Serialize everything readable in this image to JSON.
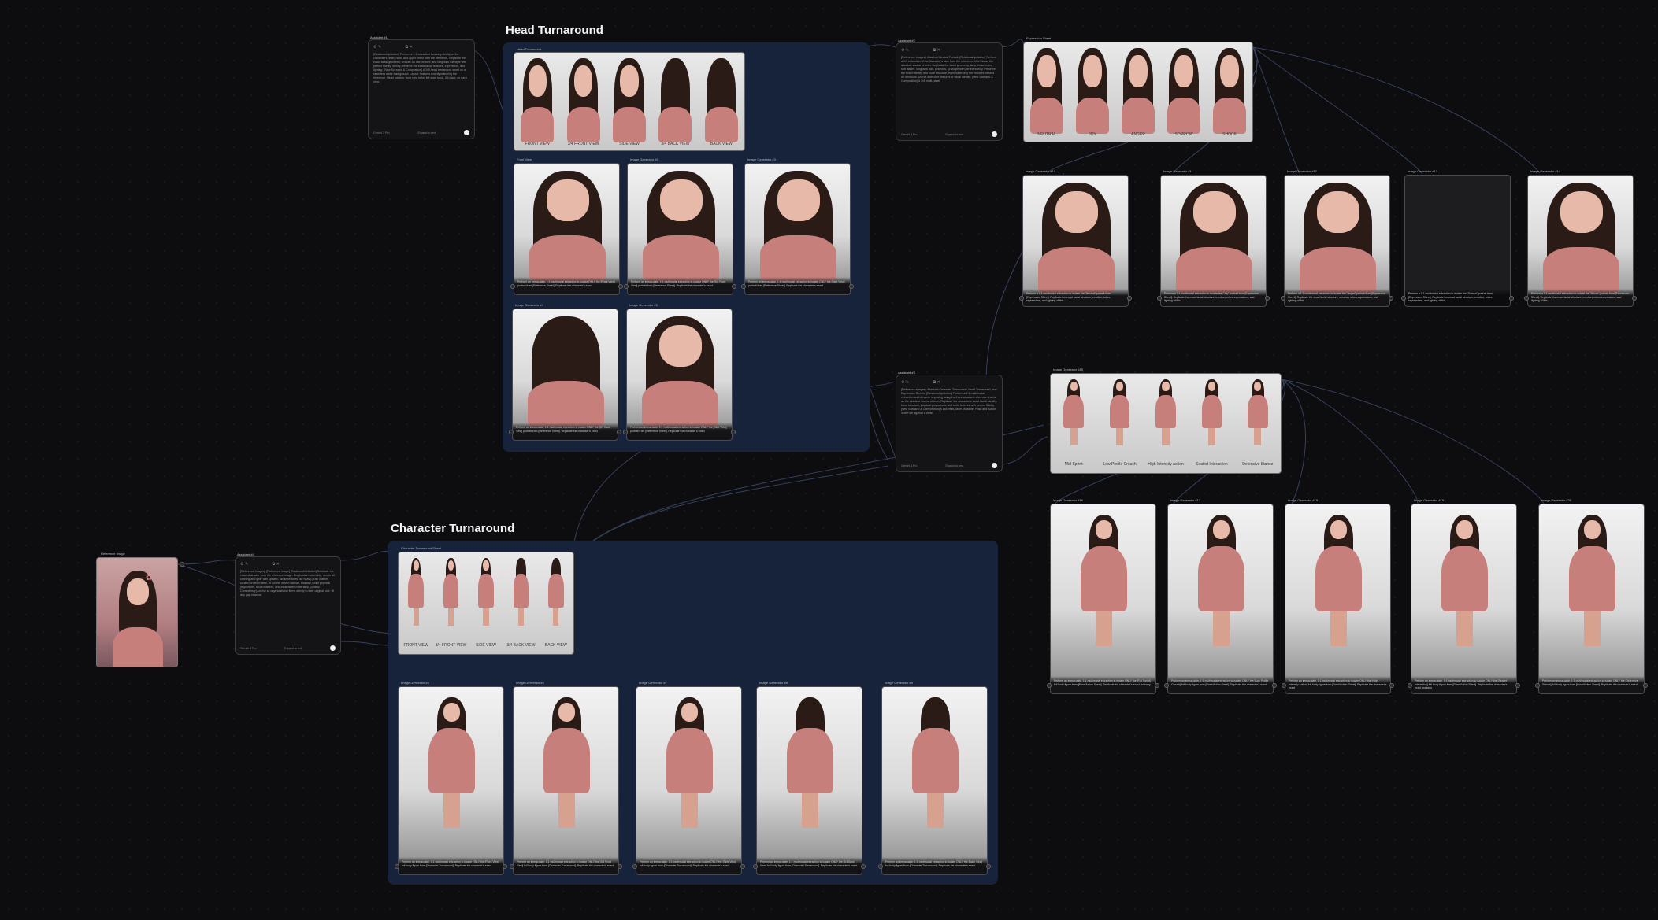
{
  "groups": {
    "head_title": "Head Turnaround",
    "character_title": "Character Turnaround"
  },
  "reference": {
    "label": "Reference Image"
  },
  "assistants": {
    "a1": {
      "title": "Assistant #1",
      "body": "[Relationship/Action] Perform a 1:1 extraction focusing strictly on the character's head, neck, and upper chest from the reference. Replicate the exact facial geometry, smooth 3D skin texture, and long dark hairstyle with perfect fidelity. Strictly preserve the exact facial features, expression, and lighting. [New Scenario & Composition] A 2x5 head turnaround sheet on a seamless white background. Layout: features exactly matching the reference. Head rotation: front view to full left side, back, 3/4 back; on each view.",
      "mode": "Gemini 3 Pro",
      "action": "Expand to text"
    },
    "a2": {
      "title": "Assistant #2",
      "body": "[Reference Images]: Attached Neutral Portrait. [Relationship/Action] Perform a 1:1 extraction of the character's face from the reference. Use this as the absolute source of truth. Replicate the facial geometry, large brown eyes, soft lashes, long dark hair, pink bow, lip shape with perfect fidelity. Preserve the exact identity and bone structure, manipulate only the muscles needed for emotions. Do not alter core features or facial identity. [New Scenario & Composition] A 1x5 multi-panel",
      "mode": "Gemini 3 Pro",
      "action": "Expand to text"
    },
    "a3": {
      "title": "Assistant #3",
      "body": "[Reference Images]: Attached Character Turnaround, Head Turnaround, and Expression Sheets. [Relationship/Action] Perform a 1:1 multimodal extraction and dynamic re-posing using the three attached reference sheets as the absolute source of truth. Replicate the character's exact facial identity, bone structure, physical proportions, and outfit textures with perfect fidelity. [New Scenario & Composition] A 1x5 multi-panel character Pose and Action Sheet set against a clean,",
      "mode": "Gemini 3 Pro",
      "action": "Expand to text"
    },
    "a4": {
      "title": "Assistant #4",
      "body": "[Reference Images]: [Reference Image] [Relationship/Action] Replicate the exact character from the reference image. Emphasize materiality: render all clothing and gear with specific, tactile textures like heavy-grain leather, scuffed brushed steel, or coarse woven canvas. Maintain exact physical proportions, facial features, and established materiality. [Spatial Consistency] Anchor all organizational items strictly to their original side, fill any gap or arrow.",
      "mode": "Gemini 3 Pro",
      "action": "Expand to text"
    }
  },
  "head_sheet": {
    "label": "Head Turnaround",
    "views": [
      "FRONT VIEW",
      "3/4 FRONT VIEW",
      "SIDE VIEW",
      "3/4 BACK VIEW",
      "BACK VIEW"
    ]
  },
  "head_cards": [
    {
      "label": "Front View",
      "caption": "Perform an immaculate, 1:1 multimodal extraction to isolate ONLY the [Front View] portrait from [Reference Sheet]. Replicate the character's exact"
    },
    {
      "label": "Image Generator #2",
      "caption": "Perform an immaculate, 1:1 multimodal extraction to isolate ONLY the [3/4 Front View] portrait from [Reference Sheet]. Replicate the character's exact"
    },
    {
      "label": "Image Generator #3",
      "caption": "Perform an immaculate, 1:1 multimodal extraction to isolate ONLY the [Side View] portrait from [Reference Sheet]. Replicate the character's exact"
    },
    {
      "label": "Image Generator #4",
      "caption": "Perform an immaculate, 1:1 multimodal extraction to isolate ONLY the [3/4 Back View] portrait from [Reference Sheet]. Replicate the character's exact"
    },
    {
      "label": "Image Generator #5",
      "caption": "Perform an immaculate, 1:1 multimodal extraction to isolate ONLY the [Side View] portrait from [Reference Sheet]. Replicate the character's exact"
    }
  ],
  "expression_sheet": {
    "label": "Expression Sheet",
    "views": [
      "NEUTRAL",
      "JOY",
      "ANGER",
      "SORROW",
      "SHOCK"
    ]
  },
  "expression_cards": [
    {
      "label": "Image Generator #10",
      "caption": "Perform a 1:1 multimodal extraction to isolate the \"Neutral\" portrait from [Expression Sheet]. Replicate the exact facial structure, emotion, micro-expressions, and lighting of this"
    },
    {
      "label": "Image Generator #11",
      "caption": "Perform a 1:1 multimodal extraction to isolate the \"Joy\" portrait from [Expression Sheet]. Replicate the exact facial structure, emotion, micro-expressions, and lighting of this"
    },
    {
      "label": "Image Generator #12",
      "caption": "Perform a 1:1 multimodal extraction to isolate the \"Anger\" portrait from [Expression Sheet]. Replicate the exact facial structure, emotion, micro-expressions, and lighting of this"
    },
    {
      "label": "Image Generator #13",
      "caption": "Perform a 1:1 multimodal extraction to isolate the \"Sorrow\" portrait from [Expression Sheet]. Replicate the exact facial structure, emotion, micro-expressions, and lighting of this"
    },
    {
      "label": "Image Generator #14",
      "caption": "Perform a 1:1 multimodal extraction to isolate the \"Shock\" portrait from [Expression Sheet]. Replicate the exact facial structure, emotion, micro-expressions, and lighting of this"
    }
  ],
  "pose_sheet": {
    "label": "Image Generator #15",
    "views": [
      "Mid-Sprint",
      "Low Profile Crouch",
      "High-Intensity Action",
      "Seated Interaction",
      "Defensive Stance"
    ]
  },
  "pose_cards": [
    {
      "label": "Image Generator #16",
      "caption": "Perform an immaculate, 1:1 multimodal extraction to isolate ONLY the [Full Sprint] full body figure from [Pose/Action Sheet]. Replicate the character's exact anatomy,"
    },
    {
      "label": "Image Generator #17",
      "caption": "Perform an immaculate, 1:1 multimodal extraction to isolate ONLY the [Low Profile Crouch] full body figure from [Pose/Action Sheet]. Replicate the character's exact"
    },
    {
      "label": "Image Generator #18",
      "caption": "Perform an immaculate, 1:1 multimodal extraction to isolate ONLY the [High-Intensity Action] full body figure from [Pose/Action Sheet]. Replicate the character's exact"
    },
    {
      "label": "Image Generator #19",
      "caption": "Perform an immaculate, 1:1 multimodal extraction to isolate ONLY the [Seated Interaction] full body figure from [Pose/Action Sheet]. Replicate the character's exact anatomy"
    },
    {
      "label": "Image Generator #20",
      "caption": "Perform an immaculate, 1:1 multimodal extraction to isolate ONLY the [Defensive Stance] full body figure from [Pose/Action Sheet]. Replicate the character's exact"
    }
  ],
  "character_sheet": {
    "label": "Character Turnaround Sheet",
    "views": [
      "FRONT VIEW",
      "3/4 FRONT VIEW",
      "SIDE VIEW",
      "3/4 BACK VIEW",
      "BACK VIEW"
    ]
  },
  "character_cards": [
    {
      "label": "Image Generator #5",
      "caption": "Perform an immaculate, 1:1 multimodal extraction to isolate ONLY the [Front View] full body figure from [Character Turnaround]. Replicate the character's exact"
    },
    {
      "label": "Image Generator #6",
      "caption": "Perform an immaculate, 1:1 multimodal extraction to isolate ONLY the [3/4 Front View] full body figure from [Character Turnaround]. Replicate the character's exact"
    },
    {
      "label": "Image Generator #7",
      "caption": "Perform an immaculate, 1:1 multimodal extraction to isolate ONLY the [Side View] full body figure from [Character Turnaround]. Replicate the character's exact"
    },
    {
      "label": "Image Generator #8",
      "caption": "Perform an immaculate, 1:1 multimodal extraction to isolate ONLY the [3/4 Back View] full body figure from [Character Turnaround]. Replicate the character's exact"
    },
    {
      "label": "Image Generator #9",
      "caption": "Perform an immaculate, 1:1 multimodal extraction to isolate ONLY the [Back View] full body figure from [Character Turnaround]. Replicate the character's exact"
    }
  ]
}
